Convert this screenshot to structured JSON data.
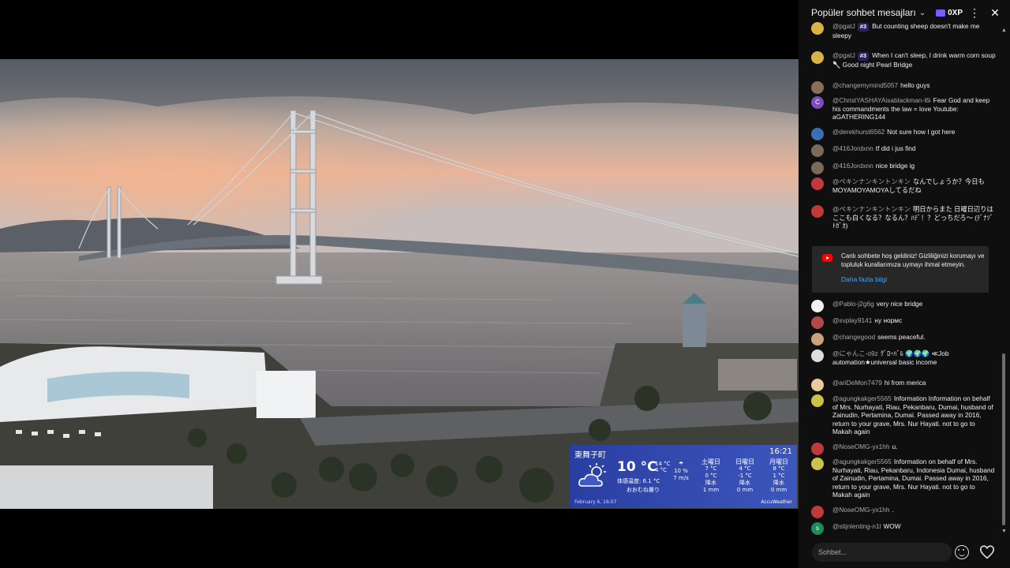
{
  "chat": {
    "title": "Popüler sohbet mesajları",
    "xp": "0XP",
    "messages": [
      {
        "author": "@pgatJ",
        "badge": "#3",
        "text": "But counting sheep doesn't make me sleepy",
        "avatar_color": "#d9b347"
      },
      {
        "author": "@pgatJ",
        "badge": "#3",
        "text": "When I can't sleep, I drink warm corn soup 🥄 Good night Pearl Bridge",
        "avatar_color": "#d9b347"
      },
      {
        "author": "@changemymind5057",
        "text": "hello guys",
        "avatar_color": "#8a6d5a"
      },
      {
        "author": "@ChristYASHAYAisablackman-l6i",
        "text": "Fear God and keep his commandments the law = love Youtube: aGATHERING144",
        "avatar_color": "#7c4dbb",
        "avatar_letter": "C"
      },
      {
        "author": "@derekhurst6562",
        "text": "Not sure how I got here",
        "avatar_color": "#3a6fb0"
      },
      {
        "author": "@416Jordxnn",
        "text": "tf did i jus find",
        "avatar_color": "#7a6a5a"
      },
      {
        "author": "@416Jordxnn",
        "text": "nice bridge ig",
        "avatar_color": "#7a6a5a"
      },
      {
        "author": "@ペキンナンキントンキン",
        "text": "なんでしょうか？今日もMOYAMOYAMOYAしてるだね",
        "avatar_color": "#c0393b"
      },
      {
        "author": "@ペキンナンキントンキン",
        "text": "明日からまた 日曜日辺りはここも白くなる？なるん？ﾊﾃﾞ！？どっちだろ〜 (ﾃﾞﾅｿﾞ ﾄｶﾞｶ)",
        "avatar_color": "#c0393b"
      },
      {
        "author": "@Pablo-j2g6g",
        "text": "very nice bridge",
        "avatar_color": "#f1f1f1"
      },
      {
        "author": "@svplay9141",
        "text": "ну нормс",
        "avatar_color": "#b04a4a"
      },
      {
        "author": "@changegood",
        "text": "seems peaceful.",
        "avatar_color": "#c9a27a"
      },
      {
        "author": "@にゃんこ-o9z",
        "text": "ｸﾞﾛｰﾊﾞﾙ 🌍🌍🌍 ≪Job automation★universal basic income",
        "avatar_color": "#dddddd"
      },
      {
        "author": "@ariDeMon7479",
        "text": "hi from merica",
        "avatar_color": "#e8c9a0"
      },
      {
        "author": "@agungkakger5565",
        "text": "Information Information on behalf of Mrs. Nurhayati, Riau, Pekanbaru, Dumai, husband of Zainudin, Pertamina, Dumai. Passed away in 2016, return to your grave, Mrs. Nur Hayati. not to go to Makah again",
        "avatar_color": "#c9c24a"
      },
      {
        "author": "@NoseOMG-yx1hh",
        "text": "u.",
        "avatar_color": "#c0393b"
      },
      {
        "author": "@agungkakger5565",
        "text": "Information on behalf of Mrs. Nurhayati, Riau, Pekanbaru, Indonesia Dumai, husband of Zainudin, Pertamina, Dumai. Passed away in 2016, return to your grave, Mrs. Nur Hayati. not to go to Makah again",
        "avatar_color": "#c9c24a"
      },
      {
        "author": "@NoseOMG-yx1hh",
        "text": ".",
        "avatar_color": "#c0393b"
      },
      {
        "author": "@stijnlenting-n1l",
        "text": "WOW",
        "avatar_color": "#1f8a5a",
        "avatar_letter": "s"
      }
    ],
    "notice": {
      "text": "Canlı sohbete hoş geldiniz! Gizliliğinizi korumayı ve topluluk kurallarımıza uymayı ihmal etmeyin.",
      "link": "Daha fazla bilgi"
    },
    "input_placeholder": "Sohbet..."
  },
  "weather": {
    "location": "東舞子町",
    "time": "16:21",
    "temp": "10 °C",
    "hi": "14 °C",
    "lo": "4 °C",
    "feels": "体感温度: 6.1 °C",
    "condition": "おおむね曇り",
    "rain_pct": "10 %",
    "wind": "7 m/s",
    "days": [
      {
        "name": "土曜日",
        "hi": "7 °C",
        "lo": "0 °C",
        "label": "降水",
        "amount": "1 mm"
      },
      {
        "name": "日曜日",
        "hi": "4 °C",
        "lo": "-1 °C",
        "label": "降水",
        "amount": "0 mm"
      },
      {
        "name": "月曜日",
        "hi": "8 °C",
        "lo": "1 °C",
        "label": "降水",
        "amount": "0 mm"
      }
    ],
    "footer": "February 6, 16:07",
    "brand": "AccuWeather"
  }
}
